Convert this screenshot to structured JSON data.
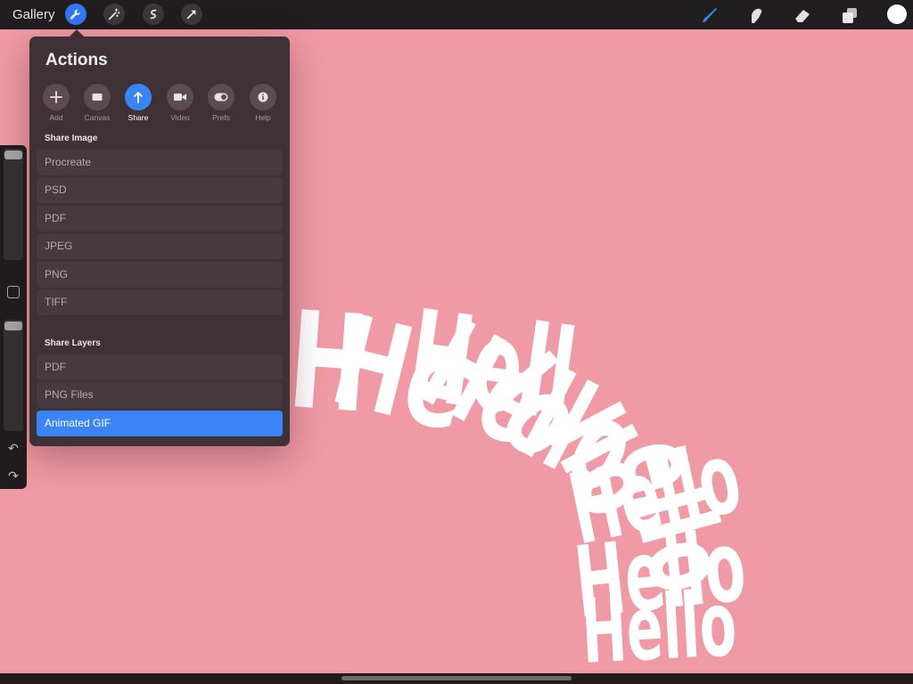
{
  "topbar": {
    "gallery_label": "Gallery",
    "left_tools": [
      "wrench-icon",
      "magic-wand-icon",
      "selection-icon",
      "transform-arrow-icon"
    ],
    "right_tools": [
      "brush-icon",
      "smudge-icon",
      "eraser-icon",
      "layers-icon"
    ],
    "accent": "#3477f6",
    "current_color": "#ffffff"
  },
  "canvas": {
    "background": "#f09aa5",
    "art_words": [
      "H",
      "He",
      "Hell",
      "Hello",
      "lo",
      "llo",
      "ello",
      "Hello",
      "Hello",
      "Hello"
    ]
  },
  "actions": {
    "title": "Actions",
    "tabs": [
      {
        "label": "Add",
        "icon": "plus-icon"
      },
      {
        "label": "Canvas",
        "icon": "canvas-icon"
      },
      {
        "label": "Share",
        "icon": "share-arrow-icon"
      },
      {
        "label": "Video",
        "icon": "video-camera-icon"
      },
      {
        "label": "Prefs",
        "icon": "toggle-icon"
      },
      {
        "label": "Help",
        "icon": "info-icon"
      }
    ],
    "active_tab": "Share",
    "share_image": {
      "heading": "Share Image",
      "items": [
        "Procreate",
        "PSD",
        "PDF",
        "JPEG",
        "PNG",
        "TIFF"
      ]
    },
    "share_layers": {
      "heading": "Share Layers",
      "items": [
        "PDF",
        "PNG Files",
        "Animated GIF"
      ],
      "selected": "Animated GIF"
    }
  },
  "sidebar": {
    "brush_size_level": 0.95,
    "opacity_level": 0.95,
    "icons": [
      "undo-icon",
      "redo-icon"
    ]
  }
}
